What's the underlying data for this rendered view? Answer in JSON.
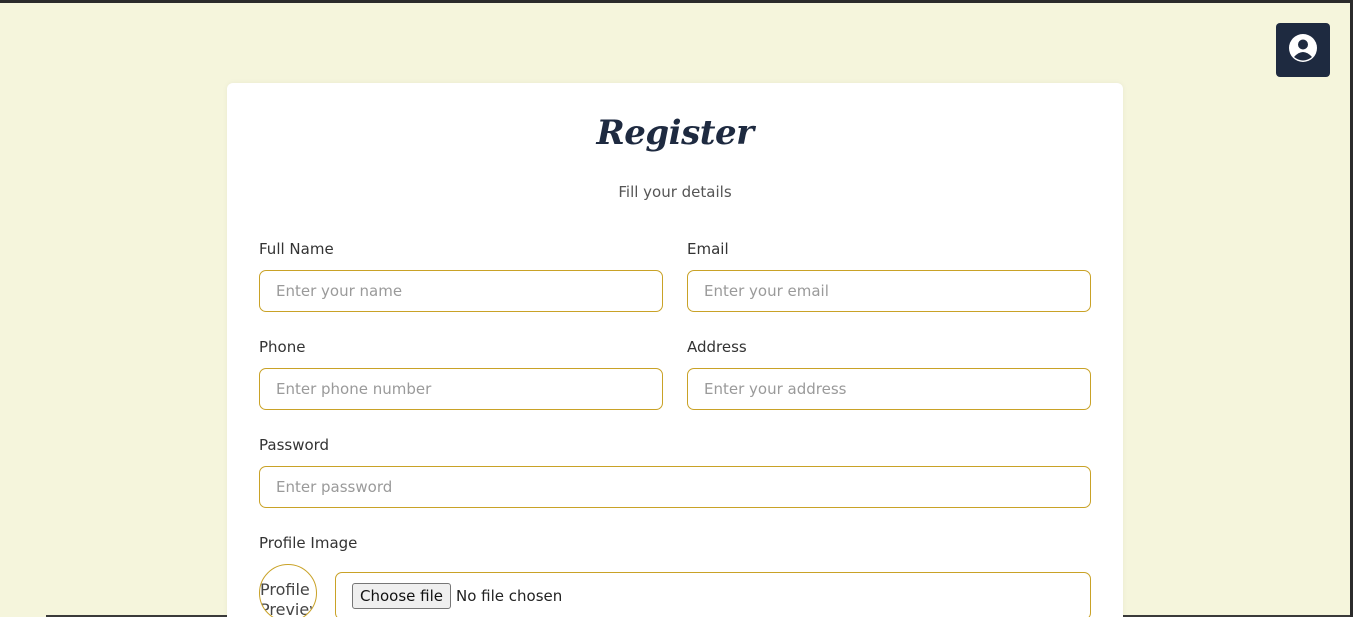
{
  "header": {
    "profile_icon": "user-circle-icon",
    "accent_color": "#1e2a40"
  },
  "form": {
    "title": "Register",
    "subtitle": "Fill your details",
    "fields": {
      "full_name": {
        "label": "Full Name",
        "placeholder": "Enter your name",
        "value": ""
      },
      "email": {
        "label": "Email",
        "placeholder": "Enter your email",
        "value": ""
      },
      "phone": {
        "label": "Phone",
        "placeholder": "Enter phone number",
        "value": ""
      },
      "address": {
        "label": "Address",
        "placeholder": "Enter your address",
        "value": ""
      },
      "password": {
        "label": "Password",
        "placeholder": "Enter password",
        "value": ""
      }
    },
    "profile_image": {
      "label": "Profile Image",
      "preview_alt": "Profile Preview",
      "choose_button": "Choose file",
      "status": "No file chosen"
    }
  },
  "colors": {
    "background": "#f5f5dc",
    "input_border": "#c9a227",
    "title": "#1e2a40"
  }
}
